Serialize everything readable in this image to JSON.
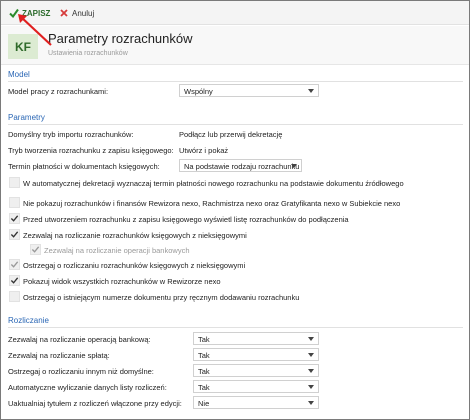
{
  "toolbar": {
    "save_label": "ZAPISZ",
    "cancel_label": "Anuluj"
  },
  "header": {
    "logo": "KF",
    "title": "Parametry rozrachunków",
    "subtitle": "Ustawienia rozrachunków"
  },
  "model": {
    "section_title": "Model",
    "field_label": "Model pracy z rozrachunkami:",
    "field_value": "Wspólny"
  },
  "parametry": {
    "section_title": "Parametry",
    "import_label": "Domyślny tryb importu rozrachunków:",
    "import_value": "Podłącz lub przerwij dekretację",
    "create_label": "Tryb tworzenia rozrachunku z zapisu księgowego:",
    "create_value": "Utwórz i pokaż",
    "term_label": "Termin płatności w dokumentach księgowych:",
    "term_value": "Na podstawie rodzaju rozrachunku",
    "checks": [
      {
        "label": "W automatycznej dekretacji wyznaczaj termin płatności nowego rozrachunku na podstawie dokumentu źródłowego",
        "checked": false
      },
      {
        "label": "Nie pokazuj rozrachunków i finansów Rewizora nexo, Rachmistrza nexo oraz Gratyfikanta nexo w Subiekcie nexo",
        "checked": false
      },
      {
        "label": "Przed utworzeniem rozrachunku z zapisu księgowego wyświetl listę rozrachunków do podłączenia",
        "checked": true
      },
      {
        "label": "Zezwalaj na rozliczanie rozrachunków księgowych z nieksięgowymi",
        "checked": true
      },
      {
        "label": "Zezwalaj na rozliczanie operacji bankowych",
        "checked": true
      },
      {
        "label": "Ostrzegaj o rozliczaniu rozrachunków księgowych z nieksięgowymi",
        "checked": true
      },
      {
        "label": "Pokazuj widok wszystkich rozrachunków w Rewizorze nexo",
        "checked": true
      },
      {
        "label": "Ostrzegaj o istniejącym numerze dokumentu przy ręcznym dodawaniu rozrachunku",
        "checked": false
      }
    ]
  },
  "rozliczanie": {
    "section_title": "Rozliczanie",
    "rows": [
      {
        "label": "Zezwalaj na rozliczanie operacją bankową:",
        "value": "Tak"
      },
      {
        "label": "Zezwalaj na rozliczanie spłatą:",
        "value": "Tak"
      },
      {
        "label": "Ostrzegaj o rozliczaniu innym niż domyślne:",
        "value": "Tak"
      },
      {
        "label": "Automatyczne wyliczanie danych listy rozliczeń:",
        "value": "Tak"
      },
      {
        "label": "Uaktualniaj tytułem z rozliczeń włączone przy edycji:",
        "value": "Nie"
      }
    ]
  },
  "colors": {
    "accent_blue": "#2b67b5",
    "save_green": "#2c6b2c",
    "cancel_red": "#d63b3b",
    "annotation_red": "#e02020"
  }
}
